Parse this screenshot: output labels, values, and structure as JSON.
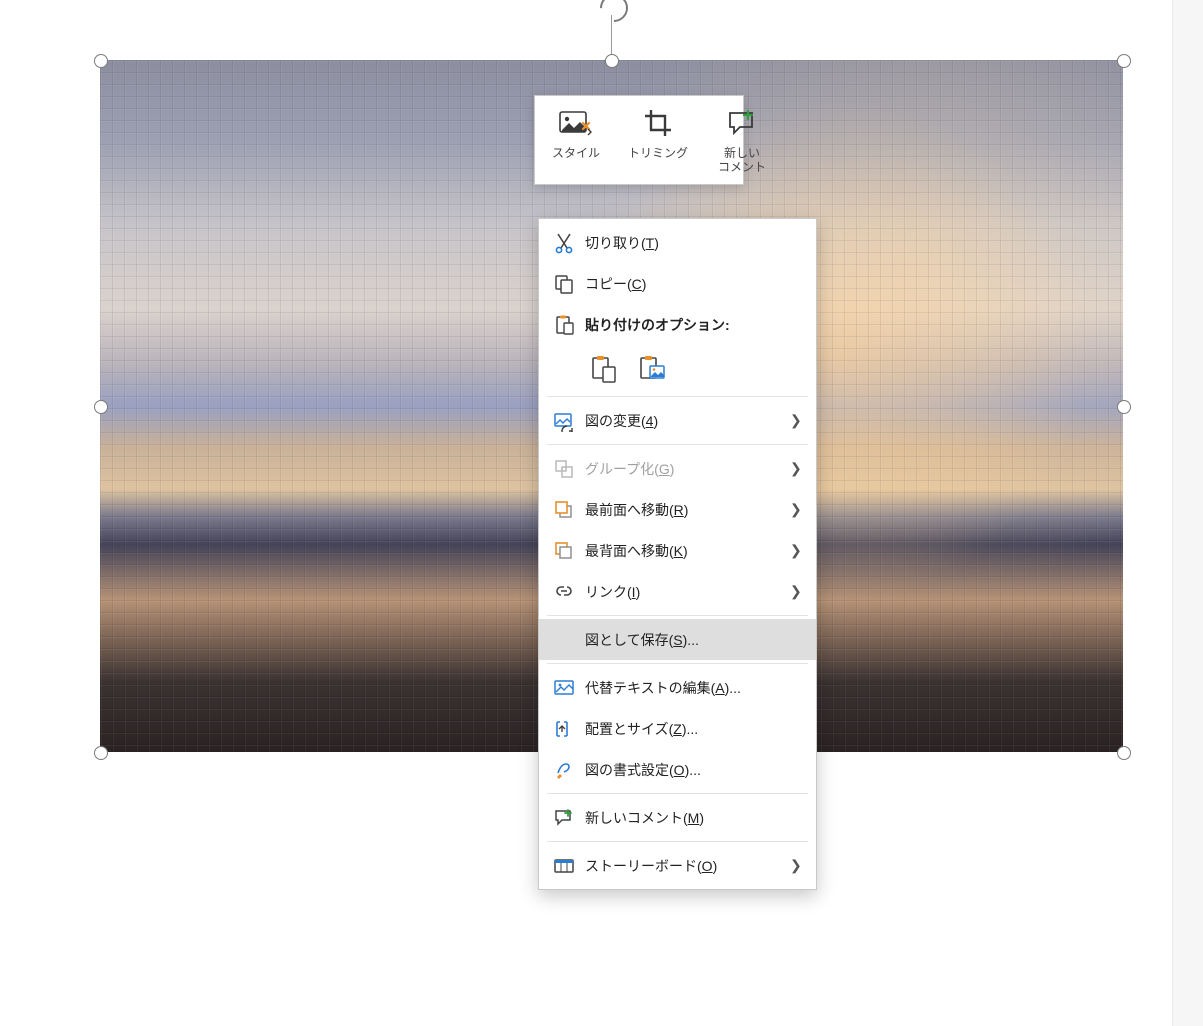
{
  "mini_toolbar": {
    "style": "スタイル",
    "crop": "トリミング",
    "new_comment_line1": "新しい",
    "new_comment_line2": "コメント"
  },
  "context_menu": {
    "cut_pre": "切り取り(",
    "cut_key": "T",
    "cut_post": ")",
    "copy_pre": "コピー(",
    "copy_key": "C",
    "copy_post": ")",
    "paste_options": "貼り付けのオプション:",
    "change_pic_pre": "図の変更(",
    "change_pic_key": "4",
    "change_pic_post": ")",
    "group_pre": "グループ化(",
    "group_key": "G",
    "group_post": ")",
    "bring_front_pre": "最前面へ移動(",
    "bring_front_key": "R",
    "bring_front_post": ")",
    "send_back_pre": "最背面へ移動(",
    "send_back_key": "K",
    "send_back_post": ")",
    "link_pre": "リンク(",
    "link_key": "I",
    "link_post": ")",
    "save_as_pic_pre": "図として保存(",
    "save_as_pic_key": "S",
    "save_as_pic_post": ")...",
    "alt_text_pre": "代替テキストの編集(",
    "alt_text_key": "A",
    "alt_text_post": ")...",
    "size_pos_pre": "配置とサイズ(",
    "size_pos_key": "Z",
    "size_pos_post": ")...",
    "format_pic_pre": "図の書式設定(",
    "format_pic_key": "O",
    "format_pic_post": ")...",
    "new_comment_pre": "新しいコメント(",
    "new_comment_key": "M",
    "new_comment_post": ")",
    "storyboard_pre": "ストーリーボード(",
    "storyboard_key": "O",
    "storyboard_post": ")"
  }
}
